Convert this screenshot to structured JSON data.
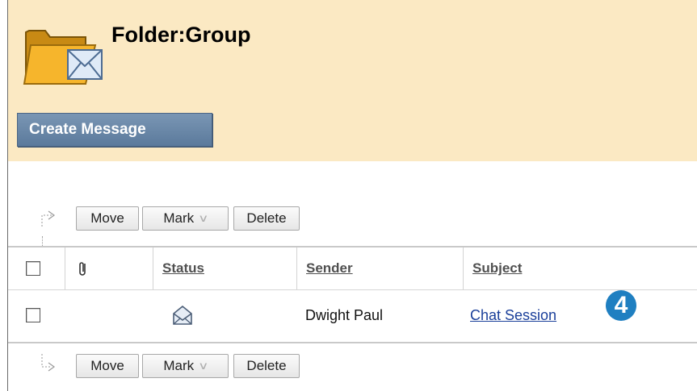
{
  "page": {
    "title": "Folder:Group",
    "create_button": "Create Message"
  },
  "toolbar": {
    "move": "Move",
    "mark": "Mark",
    "delete": "Delete"
  },
  "table": {
    "columns": {
      "status": "Status",
      "sender": "Sender",
      "subject": "Subject"
    },
    "rows": [
      {
        "sender": "Dwight Paul",
        "subject": "Chat Session",
        "status_icon": "envelope-icon"
      }
    ]
  },
  "callout": {
    "number": "4"
  },
  "colors": {
    "header_bg": "#fbe9c3",
    "button": "#5b7a9c",
    "badge": "#1f7fc1",
    "link": "#1a3f9a"
  }
}
